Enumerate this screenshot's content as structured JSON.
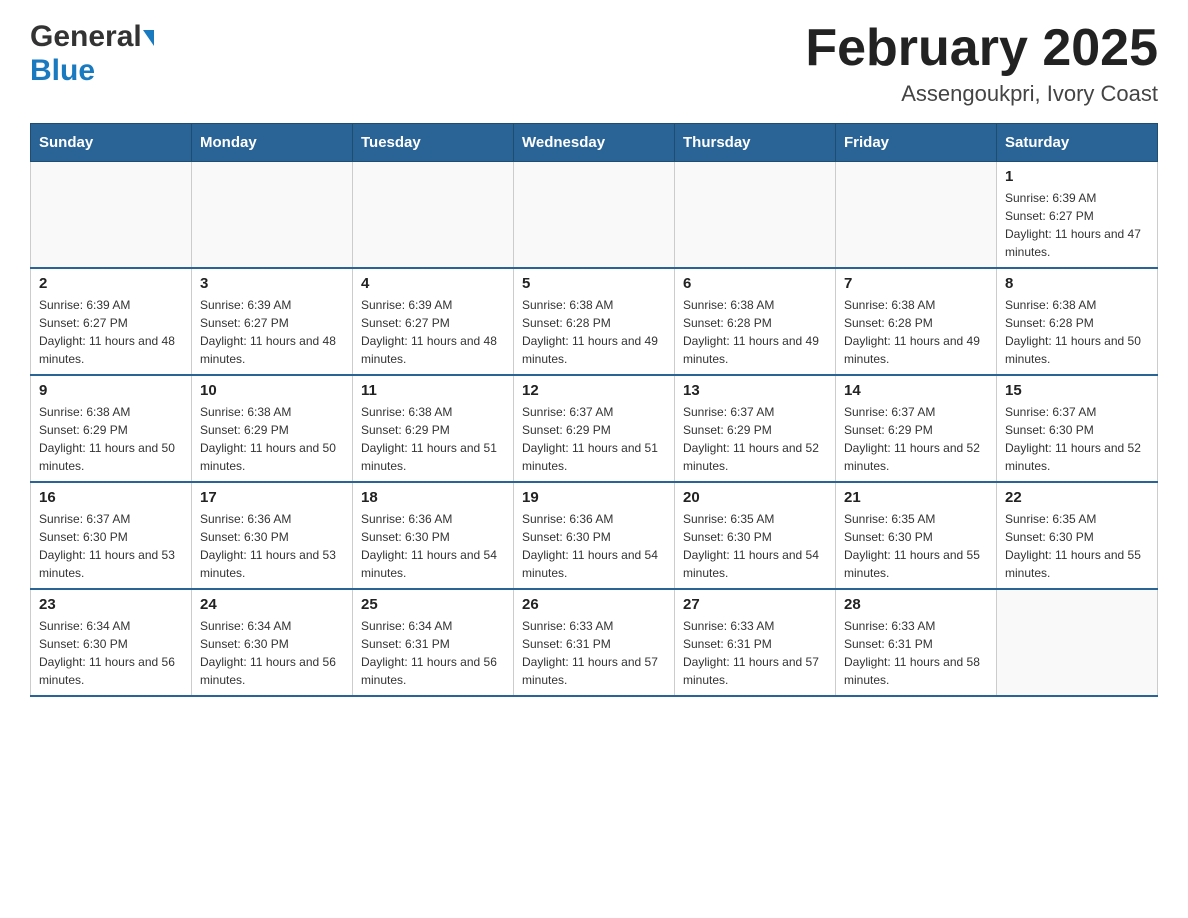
{
  "header": {
    "logo_general": "General",
    "logo_blue": "Blue",
    "month_year": "February 2025",
    "location": "Assengoukpri, Ivory Coast"
  },
  "days_of_week": [
    "Sunday",
    "Monday",
    "Tuesday",
    "Wednesday",
    "Thursday",
    "Friday",
    "Saturday"
  ],
  "weeks": [
    [
      {
        "day": "",
        "info": ""
      },
      {
        "day": "",
        "info": ""
      },
      {
        "day": "",
        "info": ""
      },
      {
        "day": "",
        "info": ""
      },
      {
        "day": "",
        "info": ""
      },
      {
        "day": "",
        "info": ""
      },
      {
        "day": "1",
        "info": "Sunrise: 6:39 AM\nSunset: 6:27 PM\nDaylight: 11 hours and 47 minutes."
      }
    ],
    [
      {
        "day": "2",
        "info": "Sunrise: 6:39 AM\nSunset: 6:27 PM\nDaylight: 11 hours and 48 minutes."
      },
      {
        "day": "3",
        "info": "Sunrise: 6:39 AM\nSunset: 6:27 PM\nDaylight: 11 hours and 48 minutes."
      },
      {
        "day": "4",
        "info": "Sunrise: 6:39 AM\nSunset: 6:27 PM\nDaylight: 11 hours and 48 minutes."
      },
      {
        "day": "5",
        "info": "Sunrise: 6:38 AM\nSunset: 6:28 PM\nDaylight: 11 hours and 49 minutes."
      },
      {
        "day": "6",
        "info": "Sunrise: 6:38 AM\nSunset: 6:28 PM\nDaylight: 11 hours and 49 minutes."
      },
      {
        "day": "7",
        "info": "Sunrise: 6:38 AM\nSunset: 6:28 PM\nDaylight: 11 hours and 49 minutes."
      },
      {
        "day": "8",
        "info": "Sunrise: 6:38 AM\nSunset: 6:28 PM\nDaylight: 11 hours and 50 minutes."
      }
    ],
    [
      {
        "day": "9",
        "info": "Sunrise: 6:38 AM\nSunset: 6:29 PM\nDaylight: 11 hours and 50 minutes."
      },
      {
        "day": "10",
        "info": "Sunrise: 6:38 AM\nSunset: 6:29 PM\nDaylight: 11 hours and 50 minutes."
      },
      {
        "day": "11",
        "info": "Sunrise: 6:38 AM\nSunset: 6:29 PM\nDaylight: 11 hours and 51 minutes."
      },
      {
        "day": "12",
        "info": "Sunrise: 6:37 AM\nSunset: 6:29 PM\nDaylight: 11 hours and 51 minutes."
      },
      {
        "day": "13",
        "info": "Sunrise: 6:37 AM\nSunset: 6:29 PM\nDaylight: 11 hours and 52 minutes."
      },
      {
        "day": "14",
        "info": "Sunrise: 6:37 AM\nSunset: 6:29 PM\nDaylight: 11 hours and 52 minutes."
      },
      {
        "day": "15",
        "info": "Sunrise: 6:37 AM\nSunset: 6:30 PM\nDaylight: 11 hours and 52 minutes."
      }
    ],
    [
      {
        "day": "16",
        "info": "Sunrise: 6:37 AM\nSunset: 6:30 PM\nDaylight: 11 hours and 53 minutes."
      },
      {
        "day": "17",
        "info": "Sunrise: 6:36 AM\nSunset: 6:30 PM\nDaylight: 11 hours and 53 minutes."
      },
      {
        "day": "18",
        "info": "Sunrise: 6:36 AM\nSunset: 6:30 PM\nDaylight: 11 hours and 54 minutes."
      },
      {
        "day": "19",
        "info": "Sunrise: 6:36 AM\nSunset: 6:30 PM\nDaylight: 11 hours and 54 minutes."
      },
      {
        "day": "20",
        "info": "Sunrise: 6:35 AM\nSunset: 6:30 PM\nDaylight: 11 hours and 54 minutes."
      },
      {
        "day": "21",
        "info": "Sunrise: 6:35 AM\nSunset: 6:30 PM\nDaylight: 11 hours and 55 minutes."
      },
      {
        "day": "22",
        "info": "Sunrise: 6:35 AM\nSunset: 6:30 PM\nDaylight: 11 hours and 55 minutes."
      }
    ],
    [
      {
        "day": "23",
        "info": "Sunrise: 6:34 AM\nSunset: 6:30 PM\nDaylight: 11 hours and 56 minutes."
      },
      {
        "day": "24",
        "info": "Sunrise: 6:34 AM\nSunset: 6:30 PM\nDaylight: 11 hours and 56 minutes."
      },
      {
        "day": "25",
        "info": "Sunrise: 6:34 AM\nSunset: 6:31 PM\nDaylight: 11 hours and 56 minutes."
      },
      {
        "day": "26",
        "info": "Sunrise: 6:33 AM\nSunset: 6:31 PM\nDaylight: 11 hours and 57 minutes."
      },
      {
        "day": "27",
        "info": "Sunrise: 6:33 AM\nSunset: 6:31 PM\nDaylight: 11 hours and 57 minutes."
      },
      {
        "day": "28",
        "info": "Sunrise: 6:33 AM\nSunset: 6:31 PM\nDaylight: 11 hours and 58 minutes."
      },
      {
        "day": "",
        "info": ""
      }
    ]
  ]
}
